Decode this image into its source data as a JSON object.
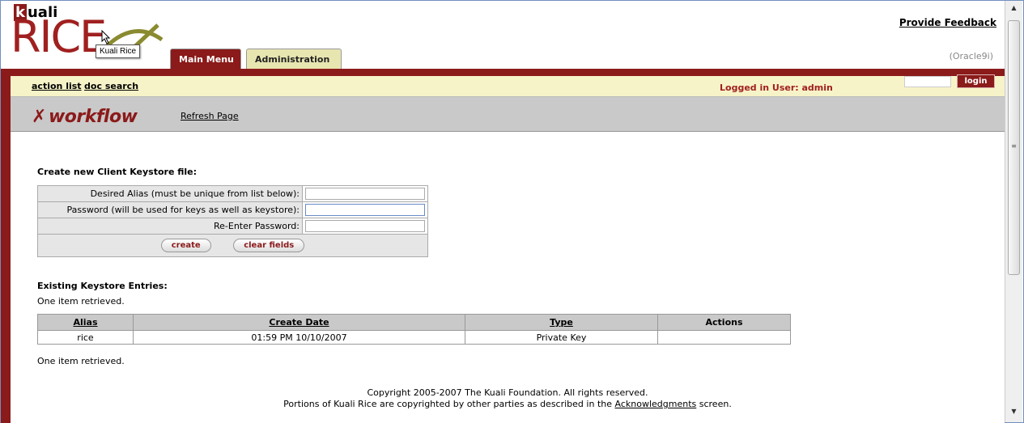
{
  "header": {
    "brand_top": "uali",
    "brand_k": "k",
    "brand_main": "RICE",
    "tooltip": "Kuali Rice",
    "tabs": [
      {
        "label": "Main Menu"
      },
      {
        "label": "Administration"
      }
    ],
    "feedback_link": "Provide Feedback",
    "db_label": "(Oracle9i)"
  },
  "actionbar": {
    "action_list": "action list",
    "doc_search": "doc search",
    "logged_in": "Logged in User: admin",
    "login_button": "login"
  },
  "workflow_bar": {
    "title": "workflow",
    "refresh": "Refresh Page"
  },
  "create_form": {
    "title": "Create new Client Keystore file:",
    "fields": [
      {
        "label": "Desired Alias (must be unique from list below):",
        "value": ""
      },
      {
        "label": "Password (will be used for keys as well as keystore):",
        "value": ""
      },
      {
        "label": "Re-Enter Password:",
        "value": ""
      }
    ],
    "create_button": "create",
    "clear_button": "clear fields"
  },
  "existing": {
    "title": "Existing Keystore Entries:",
    "retrieved_top": "One item retrieved.",
    "retrieved_bottom": "One item retrieved.",
    "columns": [
      "Alias",
      "Create Date",
      "Type",
      "Actions"
    ],
    "rows": [
      [
        "rice",
        "01:59 PM 10/10/2007",
        "Private Key",
        ""
      ]
    ]
  },
  "footer": {
    "line1": "Copyright 2005-2007 The Kuali Foundation. All rights reserved.",
    "line2_prefix": "Portions of Kuali Rice are copyrighted by other parties as described in the ",
    "line2_link": "Acknowledgments",
    "line2_suffix": " screen."
  },
  "colors": {
    "brand_red": "#8b1a1a",
    "action_yellow": "#f7f3c8",
    "bar_gray": "#c9c9c9"
  },
  "icons": [
    "cursor-arrow-icon",
    "rice-logo-swoosh-icon",
    "workflow-x-icon",
    "scroll-up-icon",
    "scroll-down-icon"
  ]
}
